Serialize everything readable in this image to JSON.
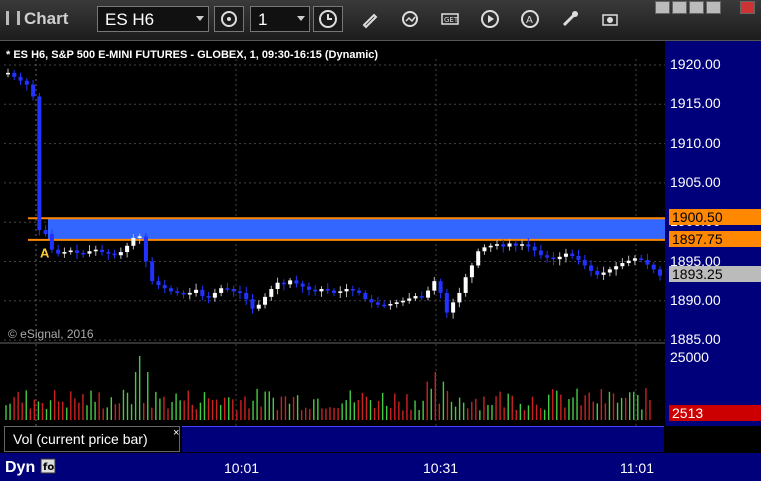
{
  "window": {
    "title": "Chart",
    "symbol": "ES H6",
    "interval": "1"
  },
  "header": {
    "description": "* ES H6, S&P 500 E-MINI FUTURES - GLOBEX, 1, 09:30-16:15 (Dynamic)"
  },
  "price_axis": {
    "ticks": [
      "1920.00",
      "1915.00",
      "1910.00",
      "1905.00",
      "1900.00",
      "1895.00",
      "1890.00",
      "1885.00"
    ],
    "upper_line_label": "1900.50",
    "lower_line_label": "1897.75",
    "last_price_label": "1893.25"
  },
  "volume_axis": {
    "max_label": "25000",
    "current_label": "2513"
  },
  "annotation": {
    "marker": "A"
  },
  "copyright": "© eSignal, 2016",
  "volume_study": {
    "label": "Vol (current price bar)",
    "close": "×"
  },
  "timebar": {
    "mode_label": "Dyn",
    "times": [
      "10:01",
      "10:31",
      "11:01"
    ]
  },
  "colors": {
    "band_fill": "#3366ff",
    "band_border": "#ff8800",
    "up_bar": "#ffffff",
    "down_bar": "#2233ff",
    "vol_up": "#44cc44",
    "vol_down": "#cc2222",
    "axis_bg": "#00007a"
  },
  "icons": [
    "chart-bars-icon",
    "combo-arrow-icon",
    "gear-cycle-icon",
    "clock-icon",
    "pencil-icon",
    "refresh-icon",
    "get-icon",
    "play-icon",
    "alert-icon",
    "tools-icon",
    "camera-icon"
  ]
}
